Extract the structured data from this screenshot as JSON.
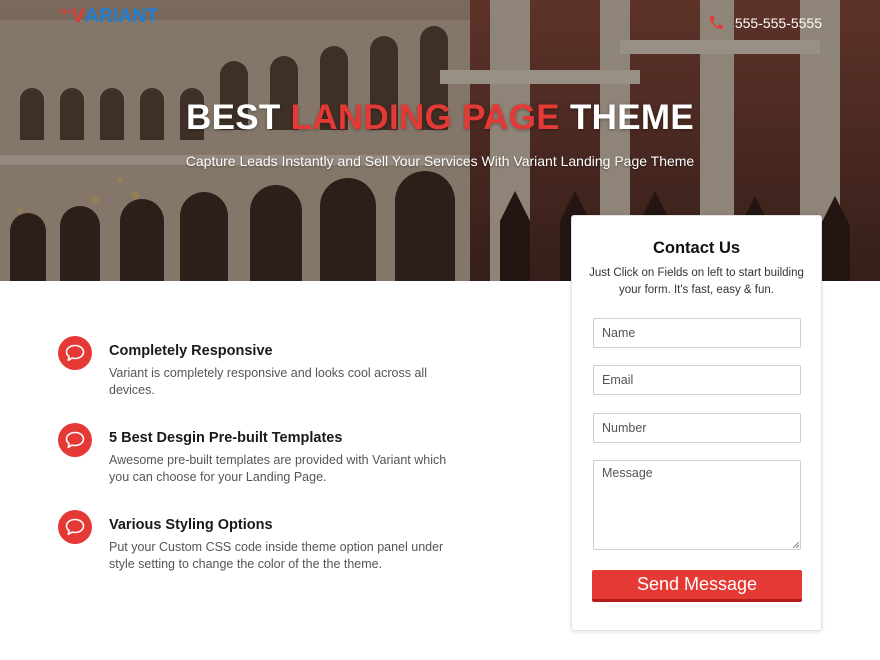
{
  "header": {
    "logo_prefix": "THE",
    "logo_first_letter": "V",
    "logo_rest": "ARIANT",
    "phone": "555-555-5555",
    "phone_icon": "phone-icon"
  },
  "hero": {
    "title_part1": "BEST ",
    "title_accent": "LANDING PAGE",
    "title_part2": " THEME",
    "subtitle": "Capture Leads Instantly and Sell Your Services With Variant Landing Page Theme"
  },
  "features": [
    {
      "icon": "speech-bubble-icon",
      "title": "Completely Responsive",
      "desc": "Variant is completely responsive and looks cool across all devices."
    },
    {
      "icon": "speech-bubble-icon",
      "title": "5 Best Desgin Pre-built Templates",
      "desc": "Awesome pre-built templates are provided with Variant which you can choose for your Landing Page."
    },
    {
      "icon": "speech-bubble-icon",
      "title": "Various Styling Options",
      "desc": "Put your Custom CSS code inside theme option panel under style setting to change the color of the the theme."
    }
  ],
  "contact": {
    "title": "Contact Us",
    "desc": "Just Click on Fields on left to start building your form. It's fast, easy & fun.",
    "name_placeholder": "Name",
    "email_placeholder": "Email",
    "number_placeholder": "Number",
    "message_placeholder": "Message",
    "submit_label": "Send Message"
  },
  "colors": {
    "accent": "#e53935",
    "logo_blue": "#1e7fd6"
  }
}
